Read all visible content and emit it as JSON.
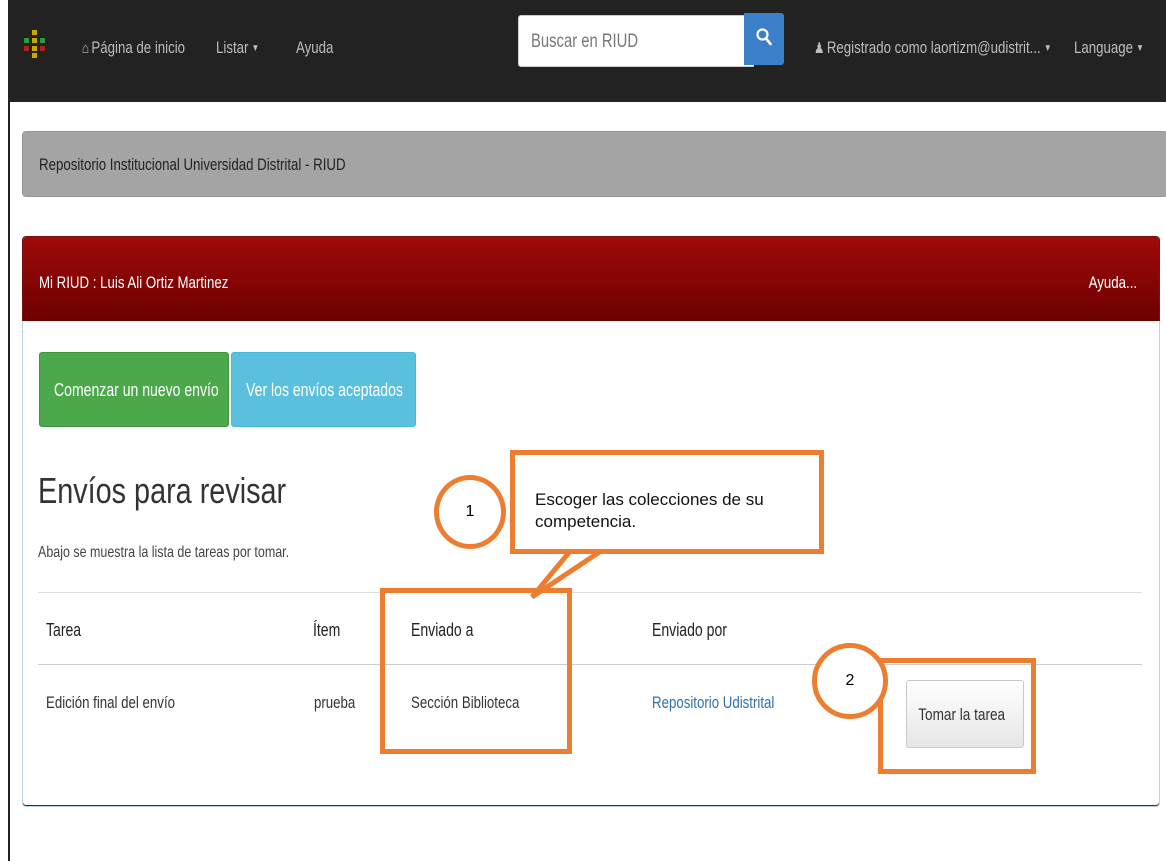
{
  "navbar": {
    "home": "Página de inicio",
    "browse": "Listar",
    "help": "Ayuda",
    "search_placeholder": "Buscar en RIUD",
    "logged_in": "Registrado como laortizm@udistrit...",
    "language": "Language"
  },
  "site": {
    "title": "Repositorio Institucional Universidad Distrital - RIUD"
  },
  "panel": {
    "title": "Mi RIUD : Luis Ali Ortiz Martinez",
    "help": "Ayuda..."
  },
  "actions": {
    "new_submission": "Comenzar un nuevo envío",
    "view_accepted": "Ver los envíos aceptados"
  },
  "review": {
    "heading": "Envíos para revisar",
    "subtitle": "Abajo se muestra la lista de tareas por tomar.",
    "columns": [
      "Tarea",
      "Ítem",
      "Enviado a",
      "Enviado por"
    ],
    "rows": [
      {
        "task": "Edición final del envío",
        "item": "prueba",
        "sent_to": "Sección Biblioteca",
        "sent_by": "Repositorio Udistrital",
        "action": "Tomar la tarea"
      }
    ]
  },
  "annotations": {
    "marker_1": "1",
    "marker_2": "2",
    "callout": "Escoger las colecciones de su competencia."
  },
  "colors": {
    "navbar": "#222222",
    "panel_header": "#8b0000",
    "annotation": "#ed7d31",
    "btn_green": "#4ba84b",
    "btn_blue": "#5bc0de",
    "link": "#3071a9"
  }
}
